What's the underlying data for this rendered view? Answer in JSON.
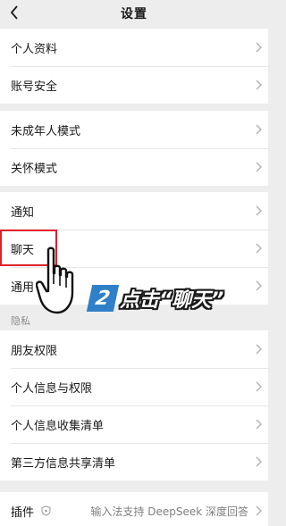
{
  "nav": {
    "title": "设置"
  },
  "groups": [
    {
      "items": [
        "个人资料",
        "账号安全"
      ]
    },
    {
      "items": [
        "未成年人模式",
        "关怀模式"
      ]
    },
    {
      "items": [
        "通知",
        "聊天",
        "通用"
      ]
    },
    {
      "label": "隐私",
      "items": [
        "朋友权限",
        "个人信息与权限",
        "个人信息收集清单",
        "第三方信息共享清单"
      ]
    },
    {
      "plugin": {
        "label": "插件",
        "value": "输入法支持 DeepSeek 深度回答"
      }
    }
  ],
  "annotation": {
    "step": "2",
    "text": "点击“聊天”"
  },
  "icons": [
    "back-arrow-icon",
    "chevron-right-icon",
    "shield-icon",
    "pointing-hand-icon"
  ],
  "colors": {
    "background": "#ededed",
    "highlight": "#e0202b",
    "badge": "#2f80c9"
  }
}
